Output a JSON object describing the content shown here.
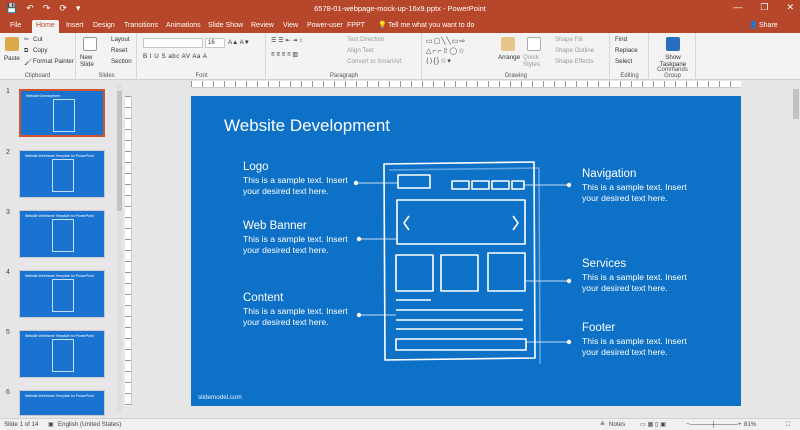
{
  "window": {
    "title": "6578-01-webpage-mock-up-16x9.pptx  -  PowerPoint",
    "quick_access": [
      "💾",
      "↶",
      "↷",
      "⟳",
      "▾"
    ],
    "controls": [
      "—",
      "❐",
      "✕"
    ]
  },
  "tabs": [
    {
      "label": "File",
      "active": false
    },
    {
      "label": "Home",
      "active": true
    },
    {
      "label": "Insert",
      "active": false
    },
    {
      "label": "Design",
      "active": false
    },
    {
      "label": "Transitions",
      "active": false
    },
    {
      "label": "Animations",
      "active": false
    },
    {
      "label": "Slide Show",
      "active": false
    },
    {
      "label": "Review",
      "active": false
    },
    {
      "label": "View",
      "active": false
    },
    {
      "label": "Power-user",
      "active": false
    },
    {
      "label": "FPPT",
      "active": false
    }
  ],
  "tell_me": "Tell me what you want to do",
  "share": "Share",
  "ribbon": {
    "clipboard": {
      "label": "Clipboard",
      "paste": "Paste",
      "cut": "Cut",
      "copy": "Copy",
      "format_painter": "Format Painter"
    },
    "slides": {
      "label": "Slides",
      "new_slide": "New Slide",
      "layout": "Layout",
      "reset": "Reset",
      "section": "Section"
    },
    "font": {
      "label": "Font",
      "size": "16",
      "buttons": "B  I  U  S  abc  AV  Aa  A"
    },
    "paragraph": {
      "label": "Paragraph",
      "text_direction": "Text Direction",
      "align_text": "Align Text",
      "convert": "Convert to SmartArt"
    },
    "drawing": {
      "label": "Drawing",
      "arrange": "Arrange",
      "quick_styles": "Quick Styles",
      "shape_fill": "Shape Fill",
      "shape_outline": "Shape Outline",
      "shape_effects": "Shape Effects"
    },
    "editing": {
      "label": "Editing",
      "find": "Find",
      "replace": "Replace",
      "select": "Select"
    },
    "commands": {
      "label": "Commands Group",
      "show_taskpane": "Show Taskpane"
    }
  },
  "thumbnails": [
    {
      "num": "1",
      "title": "Website Development",
      "selected": true
    },
    {
      "num": "2",
      "title": "Website Wireframe Template for PowerPoint",
      "selected": false
    },
    {
      "num": "3",
      "title": "Website Wireframe Template for PowerPoint",
      "selected": false
    },
    {
      "num": "4",
      "title": "Website Wireframe Template for PowerPoint",
      "selected": false
    },
    {
      "num": "5",
      "title": "Website Wireframe Template for PowerPoint",
      "selected": false
    },
    {
      "num": "6",
      "title": "Website Wireframe Template for PowerPoint",
      "selected": false
    }
  ],
  "slide": {
    "title": "Website Development",
    "footer": "slidemodel.com",
    "items": [
      {
        "head": "Logo",
        "body": "This is a sample text. Insert your desired text here."
      },
      {
        "head": "Web Banner",
        "body": "This is a sample text. Insert your desired text here."
      },
      {
        "head": "Content",
        "body": "This is a sample text. Insert your desired text here."
      },
      {
        "head": "Navigation",
        "body": "This is a sample text. Insert your desired text here."
      },
      {
        "head": "Services",
        "body": "This is a sample text. Insert your desired text here."
      },
      {
        "head": "Footer",
        "body": "This is a sample text. Insert your desired text here."
      }
    ]
  },
  "status": {
    "slide_info": "Slide 1 of 14",
    "language": "English (United States)",
    "notes": "Notes",
    "zoom": "81%"
  },
  "colors": {
    "accent": "#b7472a",
    "slide_bg": "#0e71c8"
  }
}
